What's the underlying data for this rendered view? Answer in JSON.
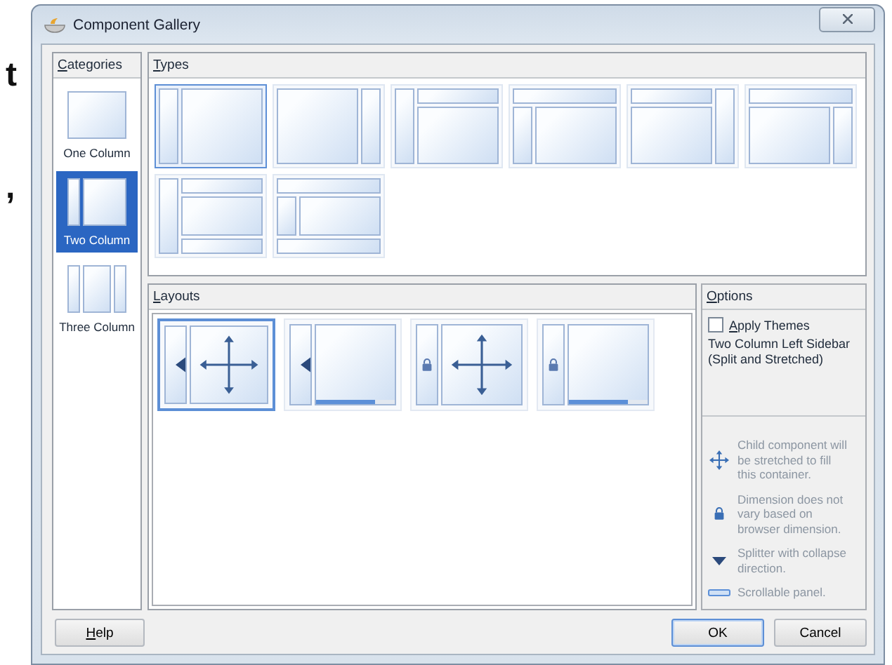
{
  "background_text": [
    "t",
    ","
  ],
  "window": {
    "title": "Component Gallery"
  },
  "categories": {
    "title": "Categories",
    "items": [
      {
        "label": "One Column",
        "kind": "one",
        "selected": false
      },
      {
        "label": "Two Column",
        "kind": "two",
        "selected": true
      },
      {
        "label": "Three Column",
        "kind": "three",
        "selected": false
      }
    ]
  },
  "types": {
    "title": "Types",
    "items": [
      {
        "kind": "left-sidebar",
        "selected": true
      },
      {
        "kind": "right-sidebar",
        "selected": false
      },
      {
        "kind": "left-header-body",
        "selected": false
      },
      {
        "kind": "header-left-body",
        "selected": false
      },
      {
        "kind": "header-body-right",
        "selected": false
      },
      {
        "kind": "header-body-rightbelow",
        "selected": false
      },
      {
        "kind": "left-header-body-footer",
        "selected": false
      },
      {
        "kind": "header-left-body-footer",
        "selected": false
      }
    ]
  },
  "layouts": {
    "title": "Layouts",
    "items": [
      {
        "kind": "split-stretched",
        "selected": true
      },
      {
        "kind": "split-scrollable",
        "selected": false
      },
      {
        "kind": "fixed-stretched",
        "selected": false
      },
      {
        "kind": "fixed-scrollable",
        "selected": false
      }
    ]
  },
  "options": {
    "title": "Options",
    "apply_themes": {
      "label": "Apply Themes",
      "checked": false
    },
    "description": "Two Column Left Sidebar (Split and Stretched)",
    "legend": [
      {
        "kind": "stretch",
        "text": "Child component will be stretched to fill this container."
      },
      {
        "kind": "fixed",
        "text": "Dimension does not vary based on browser dimension."
      },
      {
        "kind": "splitter",
        "text": "Splitter with collapse direction."
      },
      {
        "kind": "scroll",
        "text": "Scrollable panel."
      }
    ]
  },
  "buttons": [
    {
      "kind": "help",
      "label": "Help",
      "default": false
    },
    {
      "kind": "ok",
      "label": "OK",
      "default": true
    },
    {
      "kind": "cancel",
      "label": "Cancel",
      "default": false
    }
  ]
}
